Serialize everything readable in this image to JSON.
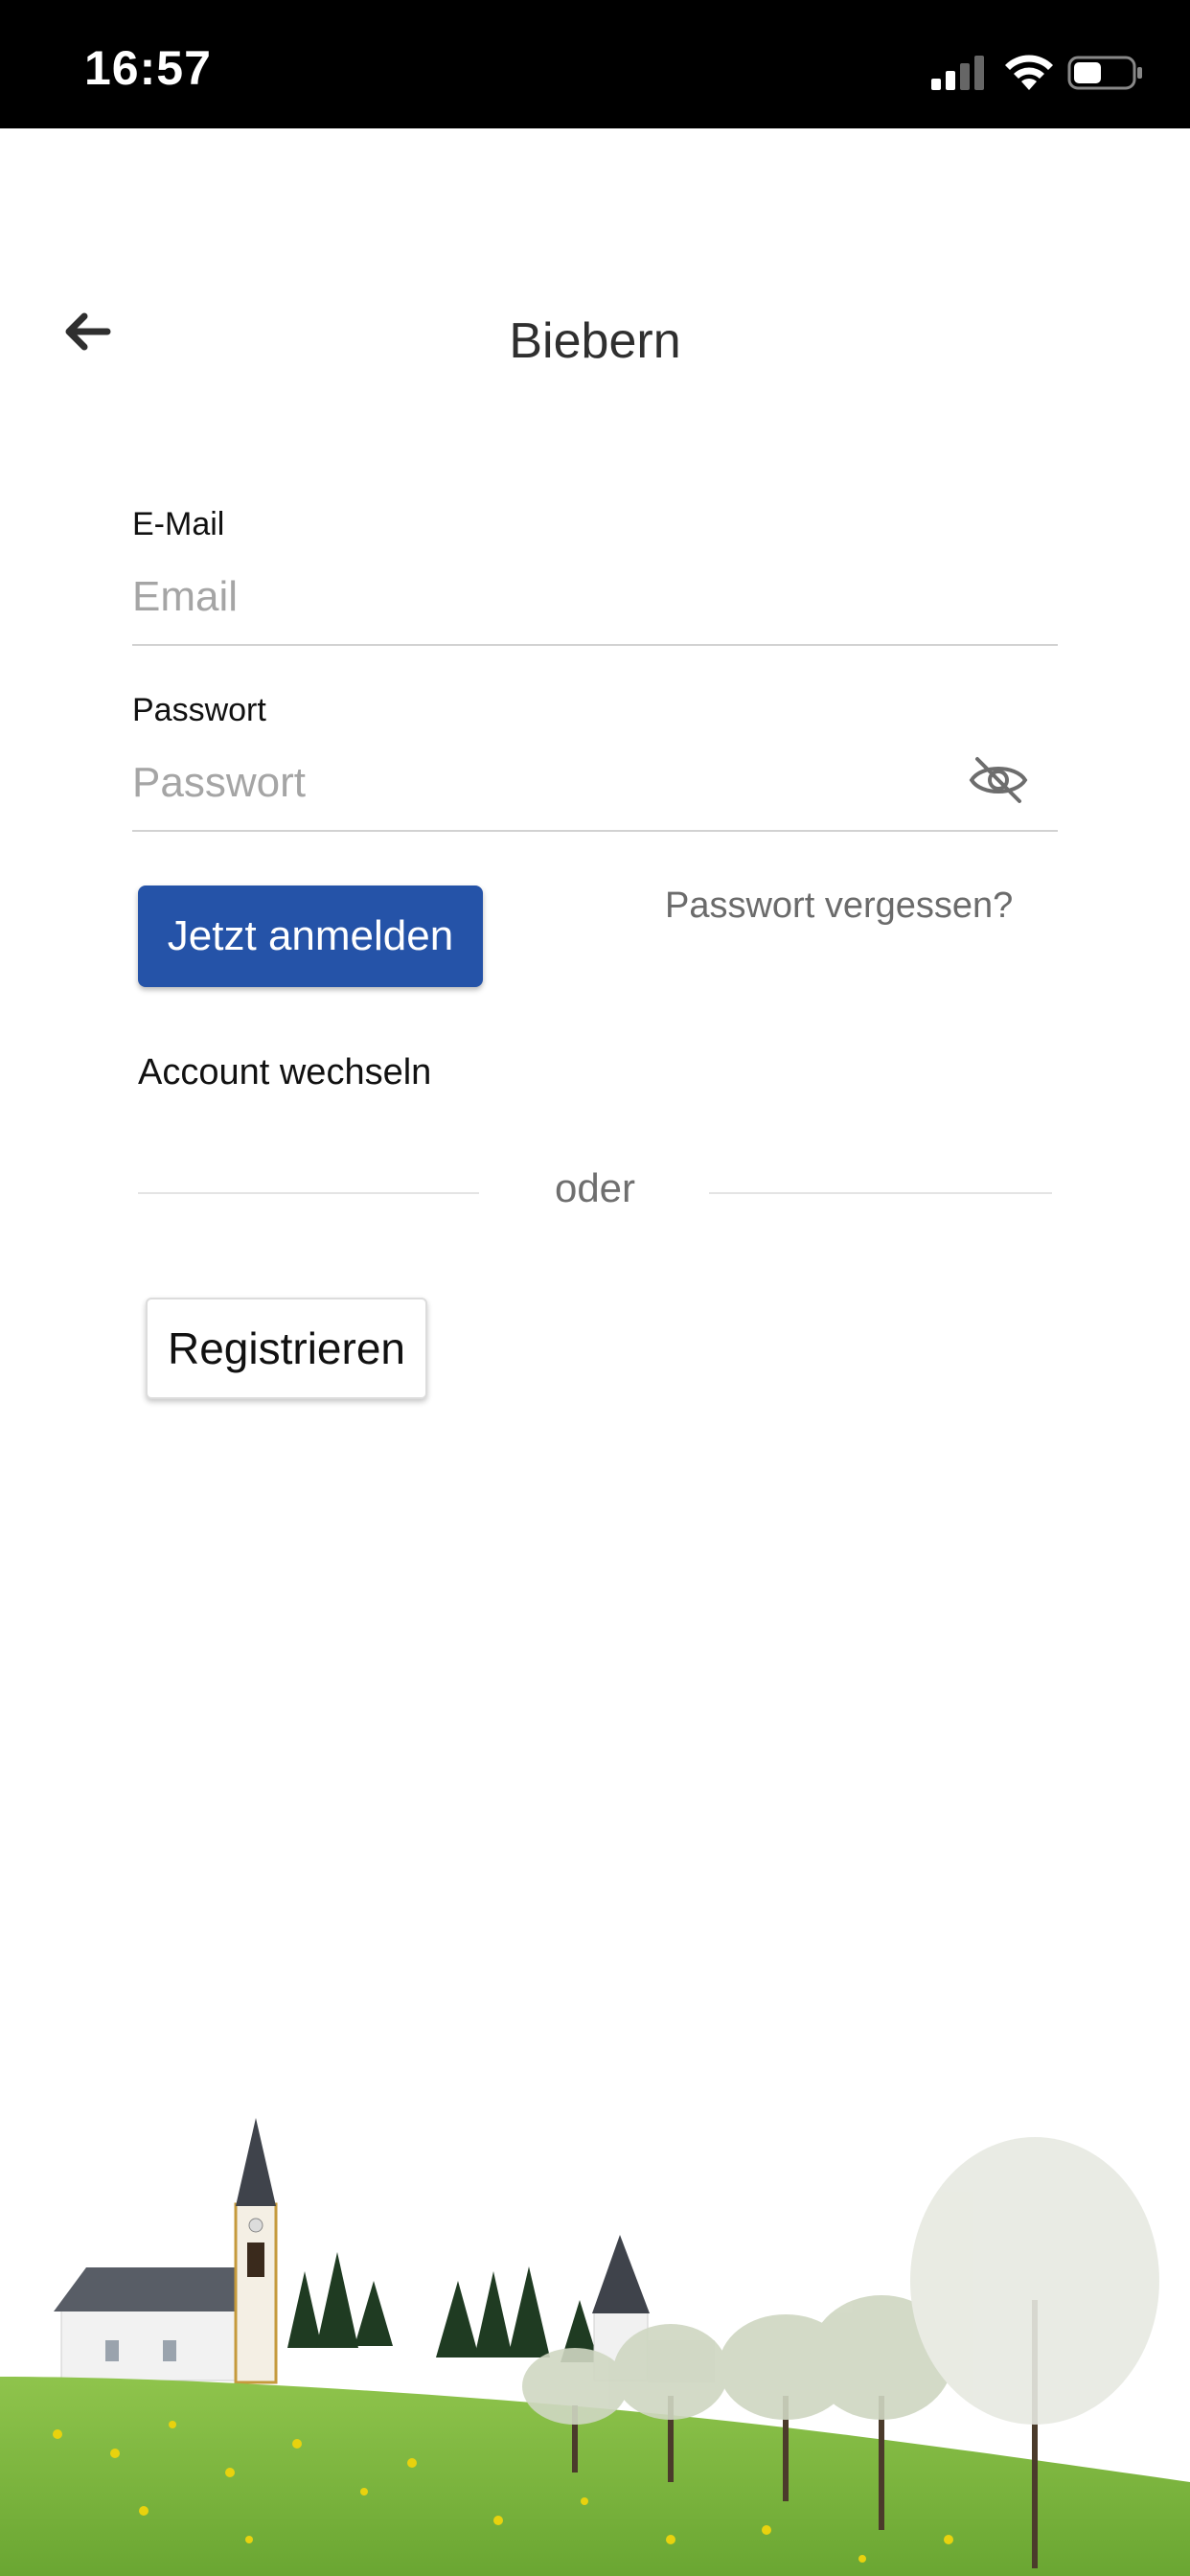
{
  "status_bar": {
    "time": "16:57"
  },
  "header": {
    "title": "Biebern",
    "back_icon": "arrow-left-icon"
  },
  "form": {
    "email_label": "E-Mail",
    "email_placeholder": "Email",
    "email_value": "",
    "password_label": "Passwort",
    "password_placeholder": "Passwort",
    "password_value": "",
    "toggle_icon": "eye-slash-icon"
  },
  "actions": {
    "login_label": "Jetzt anmelden",
    "forgot_label": "Passwort vergessen?",
    "switch_account_label": "Account wechseln",
    "divider_label": "oder",
    "register_label": "Registrieren"
  },
  "colors": {
    "primary": "#2553a8",
    "status_bar": "#000000",
    "placeholder": "#a5a5a5",
    "muted_text": "#6b6b6b"
  }
}
